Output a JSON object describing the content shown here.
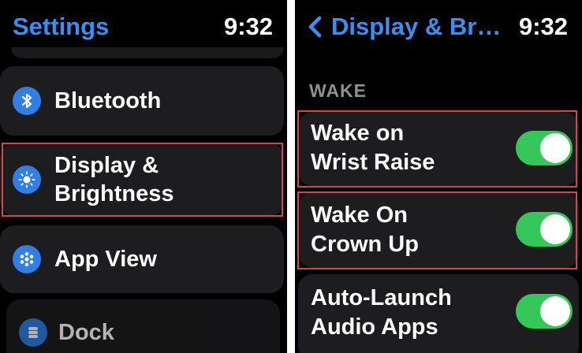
{
  "left_screen": {
    "header": {
      "title": "Settings",
      "time": "9:32"
    },
    "rows": [
      {
        "label": "Bluetooth",
        "icon": "bluetooth-icon"
      },
      {
        "label": "Display &\nBrightness",
        "icon": "sun-icon"
      },
      {
        "label": "App View",
        "icon": "app-grid-icon"
      },
      {
        "label": "Dock",
        "icon": "dock-icon"
      }
    ]
  },
  "right_screen": {
    "header": {
      "back_title": "Display & Br…",
      "time": "9:32"
    },
    "section_title": "WAKE",
    "toggles": [
      {
        "label": "Wake on\nWrist Raise",
        "on": true
      },
      {
        "label": "Wake On\nCrown Up",
        "on": true
      },
      {
        "label": "Auto-Launch\nAudio Apps",
        "on": true
      }
    ]
  },
  "colors": {
    "accent": "#3b8ff0",
    "icon_bg": "#2f7fe6",
    "cell_bg": "#1d1d1f",
    "toggle_on": "#34c759",
    "highlight": "#d9434a",
    "section_text": "#8e8e93"
  }
}
